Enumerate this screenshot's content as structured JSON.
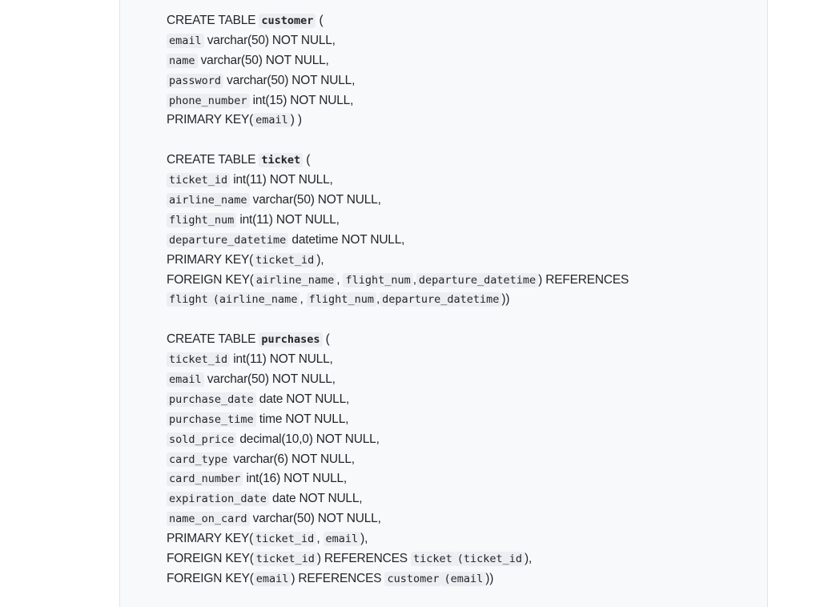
{
  "sql_blocks": [
    {
      "table": "customer",
      "lines": [
        [
          {
            "t": "text",
            "v": "CREATE TABLE "
          },
          {
            "t": "codeb",
            "v": "customer"
          },
          {
            "t": "text",
            "v": " ("
          }
        ],
        [
          {
            "t": "code",
            "v": "email"
          },
          {
            "t": "text",
            "v": " varchar(50) NOT NULL,"
          }
        ],
        [
          {
            "t": "code",
            "v": "name"
          },
          {
            "t": "text",
            "v": " varchar(50) NOT NULL,"
          }
        ],
        [
          {
            "t": "code",
            "v": "password"
          },
          {
            "t": "text",
            "v": " varchar(50) NOT NULL,"
          }
        ],
        [
          {
            "t": "code",
            "v": "phone_number"
          },
          {
            "t": "text",
            "v": " int(15) NOT NULL,"
          }
        ],
        [
          {
            "t": "text",
            "v": "PRIMARY KEY("
          },
          {
            "t": "code",
            "v": "email"
          },
          {
            "t": "text",
            "v": ") )"
          }
        ]
      ]
    },
    {
      "table": "ticket",
      "lines": [
        [
          {
            "t": "text",
            "v": "CREATE TABLE "
          },
          {
            "t": "codeb",
            "v": "ticket"
          },
          {
            "t": "text",
            "v": " ("
          }
        ],
        [
          {
            "t": "code",
            "v": "ticket_id"
          },
          {
            "t": "text",
            "v": " int(11) NOT NULL,"
          }
        ],
        [
          {
            "t": "code",
            "v": "airline_name"
          },
          {
            "t": "text",
            "v": " varchar(50) NOT NULL,"
          }
        ],
        [
          {
            "t": "code",
            "v": "flight_num"
          },
          {
            "t": "text",
            "v": " int(11) NOT NULL,"
          }
        ],
        [
          {
            "t": "code",
            "v": "departure_datetime"
          },
          {
            "t": "text",
            "v": " datetime NOT NULL,"
          }
        ],
        [
          {
            "t": "text",
            "v": "PRIMARY KEY("
          },
          {
            "t": "code",
            "v": "ticket_id"
          },
          {
            "t": "text",
            "v": "),"
          }
        ],
        [
          {
            "t": "text",
            "v": "FOREIGN KEY("
          },
          {
            "t": "code",
            "v": "airline_name"
          },
          {
            "t": "text",
            "v": ", "
          },
          {
            "t": "code",
            "v": "flight_num"
          },
          {
            "t": "text",
            "v": ","
          },
          {
            "t": "code",
            "v": "departure_datetime"
          },
          {
            "t": "text",
            "v": ") REFERENCES"
          }
        ],
        [
          {
            "t": "text",
            "v": " "
          },
          {
            "t": "code",
            "v": "flight"
          },
          {
            "t": "code",
            "v": "(airline_name"
          },
          {
            "t": "text",
            "v": ", "
          },
          {
            "t": "code",
            "v": "flight_num"
          },
          {
            "t": "text",
            "v": ","
          },
          {
            "t": "code",
            "v": "departure_datetime"
          },
          {
            "t": "text",
            "v": "))"
          }
        ]
      ]
    },
    {
      "table": "purchases",
      "lines": [
        [
          {
            "t": "text",
            "v": "CREATE TABLE "
          },
          {
            "t": "codeb",
            "v": "purchases"
          },
          {
            "t": "text",
            "v": " ("
          }
        ],
        [
          {
            "t": "code",
            "v": "ticket_id"
          },
          {
            "t": "text",
            "v": " int(11) NOT NULL,"
          }
        ],
        [
          {
            "t": "code",
            "v": "email"
          },
          {
            "t": "text",
            "v": " varchar(50) NOT NULL,"
          }
        ],
        [
          {
            "t": "code",
            "v": "purchase_date"
          },
          {
            "t": "text",
            "v": " date NOT NULL,"
          }
        ],
        [
          {
            "t": "code",
            "v": "purchase_time"
          },
          {
            "t": "text",
            "v": " time NOT NULL,"
          }
        ],
        [
          {
            "t": "code",
            "v": "sold_price"
          },
          {
            "t": "text",
            "v": " decimal(10,0) NOT NULL,"
          }
        ],
        [
          {
            "t": "code",
            "v": "card_type"
          },
          {
            "t": "text",
            "v": " varchar(6) NOT NULL,"
          }
        ],
        [
          {
            "t": "code",
            "v": "card_number"
          },
          {
            "t": "text",
            "v": " int(16) NOT NULL,"
          }
        ],
        [
          {
            "t": "code",
            "v": "expiration_date"
          },
          {
            "t": "text",
            "v": " date NOT NULL,"
          }
        ],
        [
          {
            "t": "code",
            "v": "name_on_card"
          },
          {
            "t": "text",
            "v": " varchar(50) NOT NULL,"
          }
        ],
        [
          {
            "t": "text",
            "v": "PRIMARY KEY("
          },
          {
            "t": "code",
            "v": "ticket_id"
          },
          {
            "t": "text",
            "v": ", "
          },
          {
            "t": "code",
            "v": "email"
          },
          {
            "t": "text",
            "v": "),"
          }
        ],
        [
          {
            "t": "text",
            "v": "FOREIGN KEY("
          },
          {
            "t": "code",
            "v": "ticket_id"
          },
          {
            "t": "text",
            "v": ") REFERENCES "
          },
          {
            "t": "code",
            "v": "ticket"
          },
          {
            "t": "code",
            "v": "(ticket_id"
          },
          {
            "t": "text",
            "v": "),"
          }
        ],
        [
          {
            "t": "text",
            "v": "FOREIGN KEY("
          },
          {
            "t": "code",
            "v": "email"
          },
          {
            "t": "text",
            "v": ") REFERENCES "
          },
          {
            "t": "code",
            "v": "customer"
          },
          {
            "t": "code",
            "v": "(email"
          },
          {
            "t": "text",
            "v": "))"
          }
        ]
      ]
    }
  ]
}
